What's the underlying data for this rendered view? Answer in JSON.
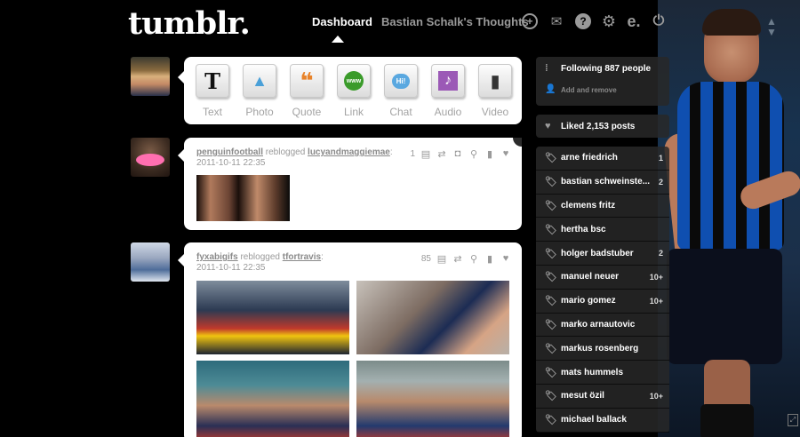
{
  "header": {
    "logo": "tumblr.",
    "nav": {
      "dashboard": "Dashboard",
      "blog": "Bastian Schalk's Thoughts"
    },
    "icons": [
      "plus-icon",
      "mail-icon",
      "help-icon",
      "gear-icon",
      "e-icon",
      "power-icon"
    ]
  },
  "post_types": [
    {
      "label": "Text",
      "icon": "T"
    },
    {
      "label": "Photo",
      "icon": "▲"
    },
    {
      "label": "Quote",
      "icon": "❝"
    },
    {
      "label": "Link",
      "icon": "www"
    },
    {
      "label": "Chat",
      "icon": "Hi!"
    },
    {
      "label": "Audio",
      "icon": "♪"
    },
    {
      "label": "Video",
      "icon": "▮"
    }
  ],
  "posts": [
    {
      "user": "penguinfootball",
      "action": "reblogged",
      "source": "lucyandmaggiemae",
      "time": "2011-10-11 22:35",
      "notes": "1"
    },
    {
      "user": "fyxabigifs",
      "action": "reblogged",
      "source": "tfortravis",
      "time": "2011-10-11 22:35",
      "notes": "85"
    }
  ],
  "sidebar": {
    "following": "Following 887 people",
    "add_remove": "Add and remove",
    "liked": "Liked 2,153 posts",
    "tags": [
      {
        "name": "arne friedrich",
        "count": "1"
      },
      {
        "name": "bastian schweinste...",
        "count": "2"
      },
      {
        "name": "clemens fritz",
        "count": ""
      },
      {
        "name": "hertha bsc",
        "count": ""
      },
      {
        "name": "holger badstuber",
        "count": "2"
      },
      {
        "name": "manuel neuer",
        "count": "10+"
      },
      {
        "name": "mario gomez",
        "count": "10+"
      },
      {
        "name": "marko arnautovic",
        "count": ""
      },
      {
        "name": "markus rosenberg",
        "count": ""
      },
      {
        "name": "mats hummels",
        "count": ""
      },
      {
        "name": "mesut özil",
        "count": "10+"
      },
      {
        "name": "michael ballack",
        "count": ""
      }
    ]
  },
  "colors": {
    "background": "#000000",
    "panel": "#ffffff",
    "sidebar": "#282828",
    "accent_pink": "#ff6fb0"
  }
}
